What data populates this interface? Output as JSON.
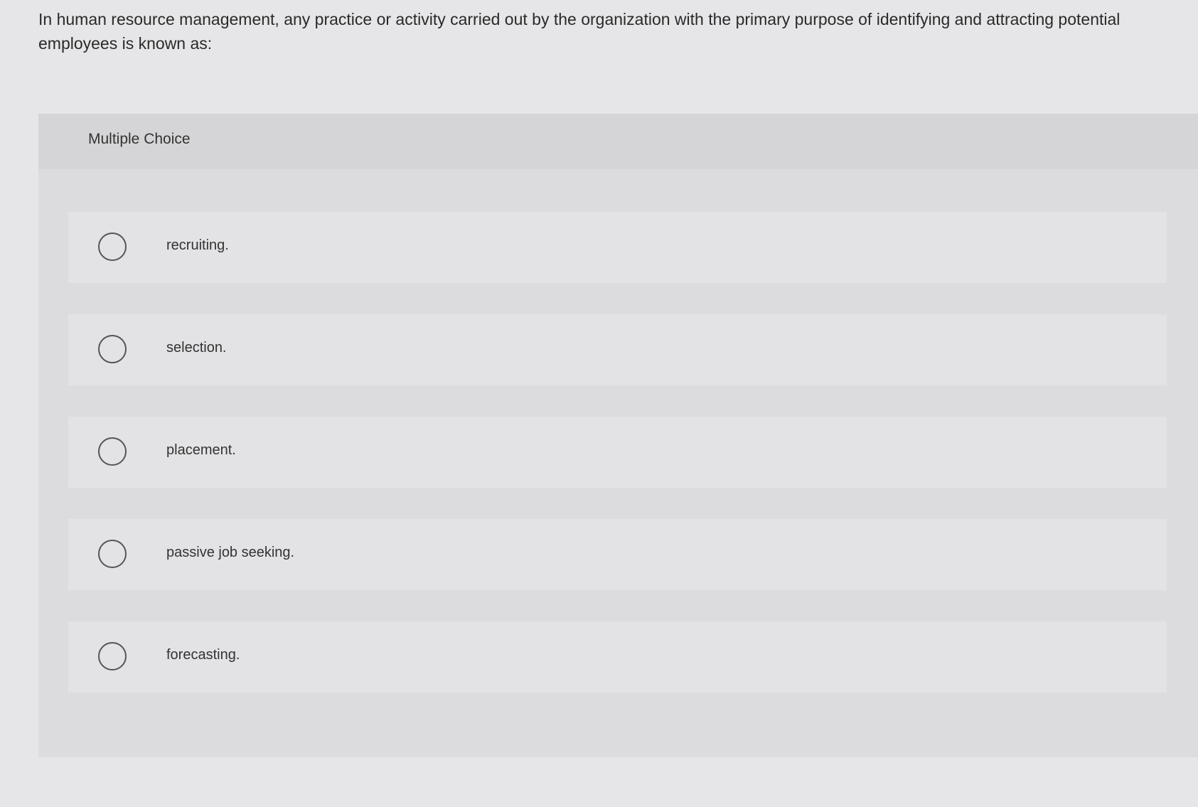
{
  "question": {
    "text": "In human resource management, any practice or activity carried out by the organization with the primary purpose of identifying and attracting potential employees is known as:"
  },
  "multiple_choice": {
    "title": "Multiple Choice",
    "options": [
      {
        "label": "recruiting."
      },
      {
        "label": "selection."
      },
      {
        "label": "placement."
      },
      {
        "label": "passive job seeking."
      },
      {
        "label": "forecasting."
      }
    ]
  },
  "colors": {
    "background": "#e6e6e8",
    "panel": "#dcdcde",
    "option_background": "#e3e3e5",
    "text": "#2b2b2b",
    "radio_border": "#555555"
  }
}
